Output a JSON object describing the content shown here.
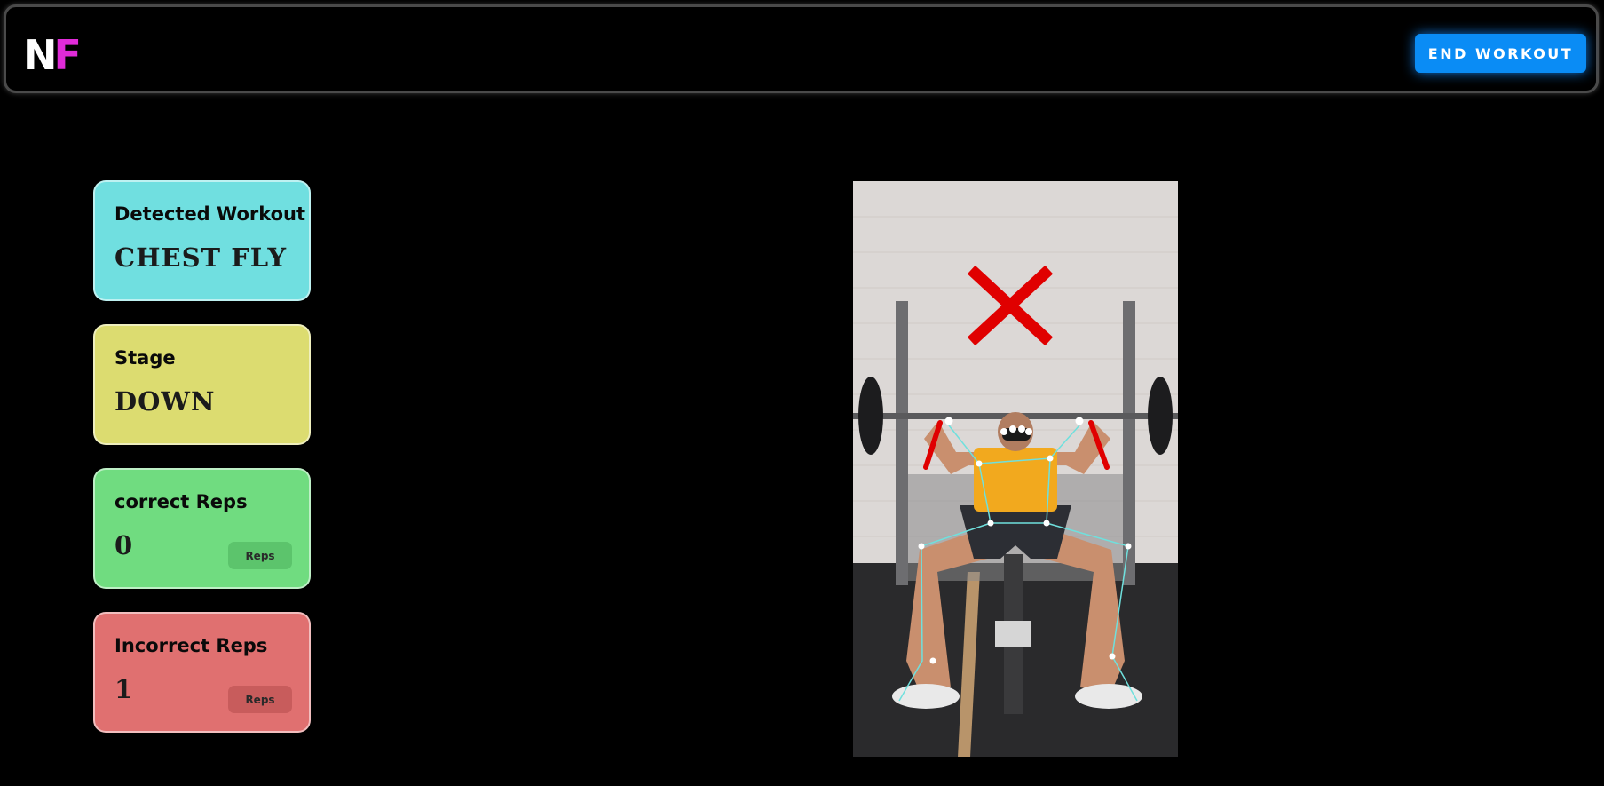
{
  "header": {
    "logo": {
      "first": "N",
      "second": "F"
    },
    "end_button_label": "END WORKOUT"
  },
  "cards": {
    "workout": {
      "title": "Detected Workout",
      "value": "CHEST FLY"
    },
    "stage": {
      "title": "Stage",
      "value": "DOWN"
    },
    "correct": {
      "title": "correct Reps",
      "value": "0",
      "badge": "Reps"
    },
    "incorrect": {
      "title": "Incorrect Reps",
      "value": "1",
      "badge": "Reps"
    }
  },
  "video": {
    "feedback_icon": "x-mark-icon",
    "feedback_color": "#e00000",
    "skeleton_color": "#6fe0dd"
  },
  "colors": {
    "accent": "#0a8cf5",
    "workout_card": "#70dfe0",
    "stage_card": "#dcdc70",
    "correct_card": "#70dc80",
    "incorrect_card": "#e07070"
  }
}
